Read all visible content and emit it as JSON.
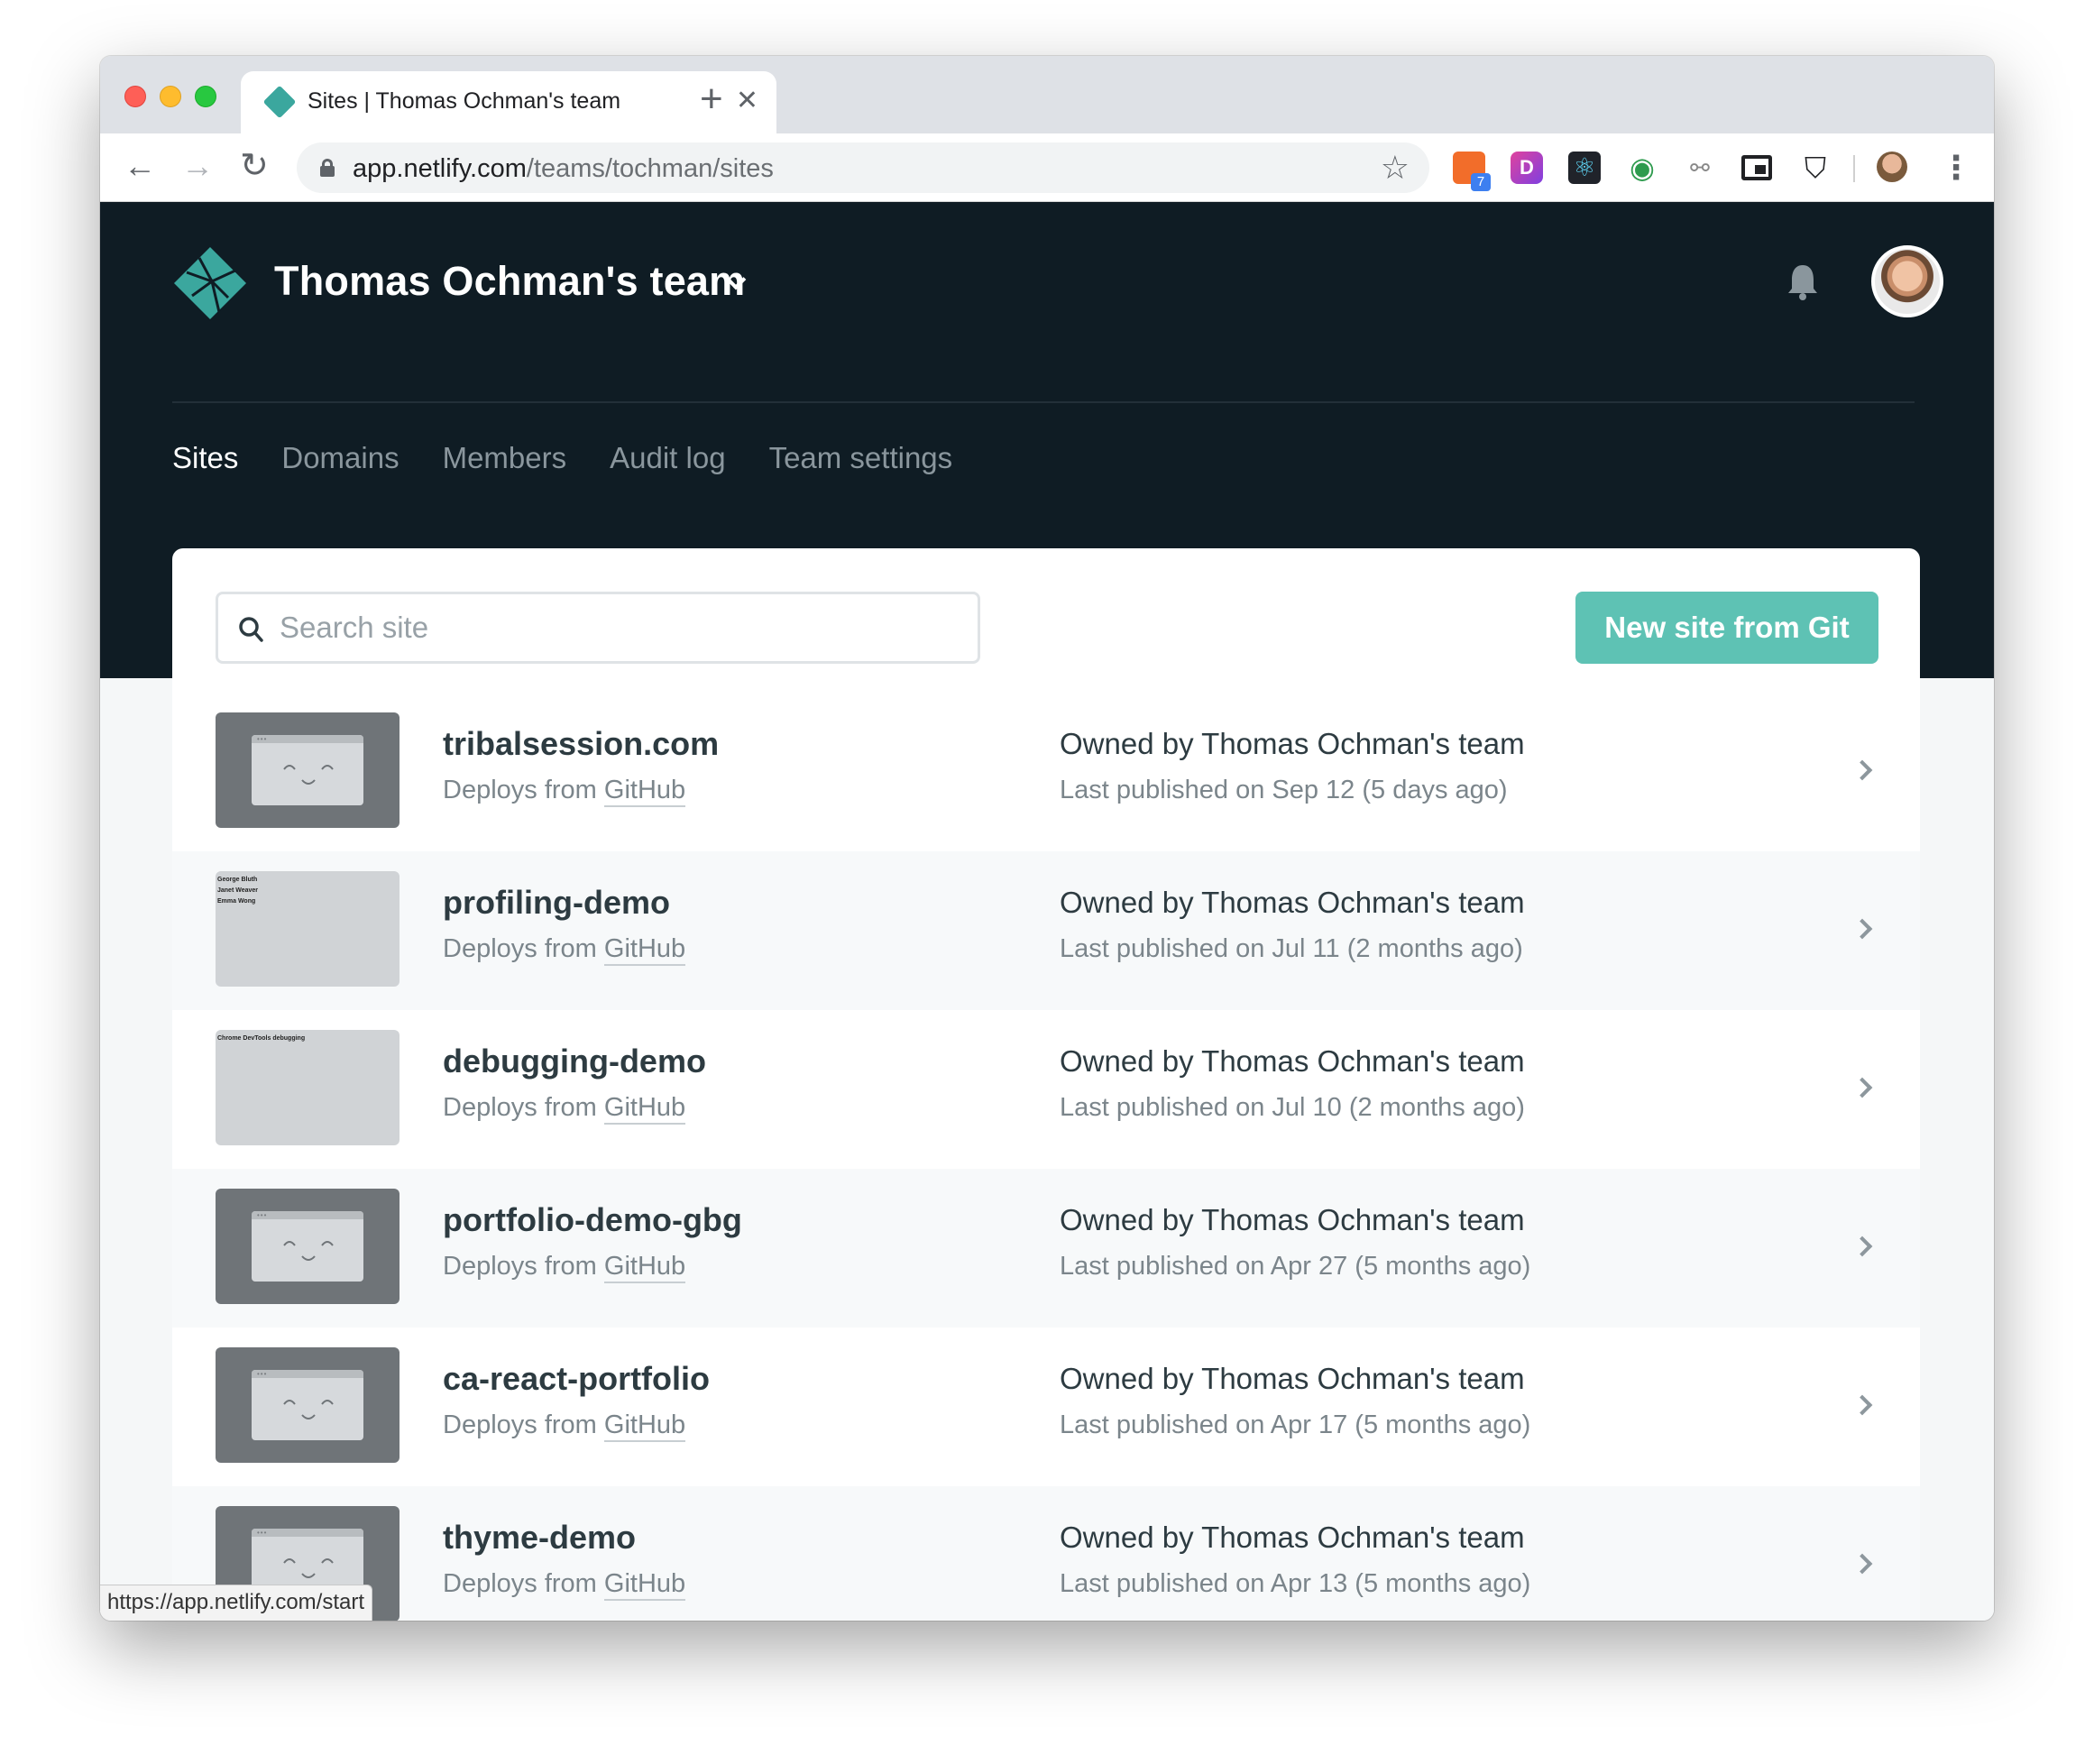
{
  "browser": {
    "tab_title": "Sites | Thomas Ochman's team",
    "tab_close": "✕",
    "new_tab": "+",
    "url_host": "app.netlify.com",
    "url_path": "/teams/tochman/sites",
    "extension_badge": "7",
    "extension_d_letter": "D",
    "status_url": "https://app.netlify.com/start"
  },
  "header": {
    "team_name": "Thomas Ochman's team",
    "nav": [
      {
        "label": "Sites",
        "active": true
      },
      {
        "label": "Domains",
        "active": false
      },
      {
        "label": "Members",
        "active": false
      },
      {
        "label": "Audit log",
        "active": false
      },
      {
        "label": "Team settings",
        "active": false
      }
    ]
  },
  "toolbar": {
    "search_placeholder": "Search site",
    "new_site_label": "New site from Git"
  },
  "sites": [
    {
      "name": "tribalsession.com",
      "deploy_prefix": "Deploys from ",
      "deploy_source": "GitHub",
      "owner_prefix": "Owned by ",
      "owner": "Thomas Ochman's team",
      "published": "Last published on Sep 12 (5 days ago)",
      "thumb": "placeholder"
    },
    {
      "name": "profiling-demo",
      "deploy_prefix": "Deploys from ",
      "deploy_source": "GitHub",
      "owner_prefix": "Owned by ",
      "owner": "Thomas Ochman's team",
      "published": "Last published on Jul 11 (2 months ago)",
      "thumb": "shot",
      "thumb_text": "George Bluth\nJanet Weaver\nEmma Wong"
    },
    {
      "name": "debugging-demo",
      "deploy_prefix": "Deploys from ",
      "deploy_source": "GitHub",
      "owner_prefix": "Owned by ",
      "owner": "Thomas Ochman's team",
      "published": "Last published on Jul 10 (2 months ago)",
      "thumb": "shot",
      "thumb_text": "Chrome DevTools debugging"
    },
    {
      "name": "portfolio-demo-gbg",
      "deploy_prefix": "Deploys from ",
      "deploy_source": "GitHub",
      "owner_prefix": "Owned by ",
      "owner": "Thomas Ochman's team",
      "published": "Last published on Apr 27 (5 months ago)",
      "thumb": "placeholder"
    },
    {
      "name": "ca-react-portfolio",
      "deploy_prefix": "Deploys from ",
      "deploy_source": "GitHub",
      "owner_prefix": "Owned by ",
      "owner": "Thomas Ochman's team",
      "published": "Last published on Apr 17 (5 months ago)",
      "thumb": "placeholder"
    },
    {
      "name": "thyme-demo",
      "deploy_prefix": "Deploys from ",
      "deploy_source": "GitHub",
      "owner_prefix": "Owned by ",
      "owner": "Thomas Ochman's team",
      "published": "Last published on Apr 13 (5 months ago)",
      "thumb": "placeholder"
    }
  ],
  "colors": {
    "header_bg": "#0f1c24",
    "accent": "#5ec2b4",
    "logo": "#3ba79e"
  }
}
